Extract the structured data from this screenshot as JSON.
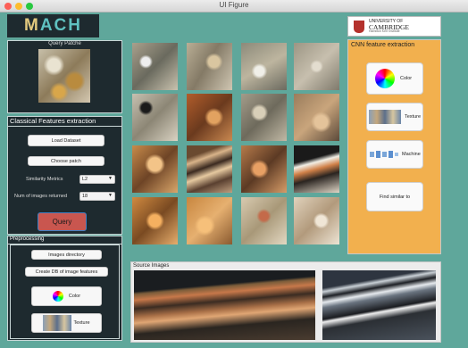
{
  "window": {
    "title": "UI Figure"
  },
  "logo": {
    "m": "M",
    "rest": "ACH"
  },
  "query_patch": {
    "label": "Query Patche"
  },
  "classical": {
    "title": "Classical Features extraction",
    "load_dataset": "Load Dataset",
    "choose_patch": "Choose patch",
    "similarity_label": "Similarity Metrics",
    "similarity_value": "L2",
    "num_images_label": "Num of images returned",
    "num_images_value": "18",
    "query_button": "Query"
  },
  "preprocessing": {
    "title": "Preprocessing",
    "images_directory": "Images directory",
    "create_db": "Create DB of image features",
    "color": "Color",
    "texture": "Texture"
  },
  "source": {
    "label": "Source Images"
  },
  "university": {
    "line1": "UNIVERSITY OF",
    "line2": "CAMBRIDGE",
    "line3": "Hamilton Kerr Institute"
  },
  "cnn": {
    "title": "CNN feature extraction",
    "color": "Color",
    "texture": "Texture",
    "machine": "Machine",
    "find_similar": "Find similar to"
  },
  "colors": {
    "background": "#5fa79b",
    "panel": "#1e2a2f",
    "cnn_panel": "#f2b04e",
    "query_button": "#c9564f"
  },
  "icons": [
    "color-wheel-icon",
    "texture-icon",
    "machine-icon",
    "university-crest-icon"
  ]
}
